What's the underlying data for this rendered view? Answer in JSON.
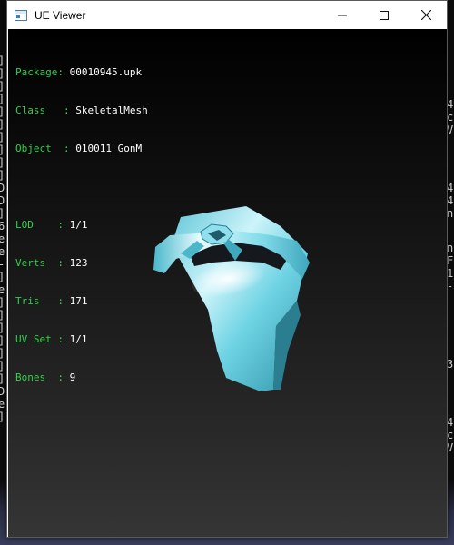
{
  "window": {
    "title": "UE Viewer",
    "controls": {
      "minimize": "minimize-icon",
      "maximize": "maximize-icon",
      "close": "close-icon"
    }
  },
  "info": {
    "package": {
      "key": "Package: ",
      "value": "00010945.upk"
    },
    "class": {
      "key": "Class   : ",
      "value": "SkeletalMesh"
    },
    "object": {
      "key": "Object  : ",
      "value": "010011_GonM"
    },
    "lod": {
      "key": "LOD    : ",
      "value": "1/1"
    },
    "verts": {
      "key": "Verts  : ",
      "value": "123"
    },
    "tris": {
      "key": "Tris   : ",
      "value": "171"
    },
    "uvset": {
      "key": "UV Set : ",
      "value": "1/1"
    },
    "bones": {
      "key": "Bones  : ",
      "value": "9"
    }
  },
  "colors": {
    "label": "#2fd24a",
    "value": "#ffffff",
    "mesh": "#6fd0e0"
  },
  "background": {
    "left_column": [
      "]",
      "]",
      "]",
      "]",
      "]",
      "]",
      "]",
      "]",
      "]",
      "]",
      "D",
      "D",
      "]",
      "6",
      "e",
      "e",
      "-",
      "]",
      "e",
      "]",
      "]",
      "]",
      "]",
      "]",
      "]",
      "]",
      "D",
      "e",
      "]"
    ],
    "right_fragments": [
      {
        "lines": [
          "4",
          "c",
          "V"
        ]
      },
      {
        "lines": [
          "4",
          "4",
          "n"
        ]
      },
      {
        "lines": [
          "n",
          "F",
          "1",
          "-"
        ]
      },
      {
        "lines": [
          "3"
        ]
      },
      {
        "lines": [
          "4",
          "c",
          "V"
        ]
      }
    ]
  }
}
